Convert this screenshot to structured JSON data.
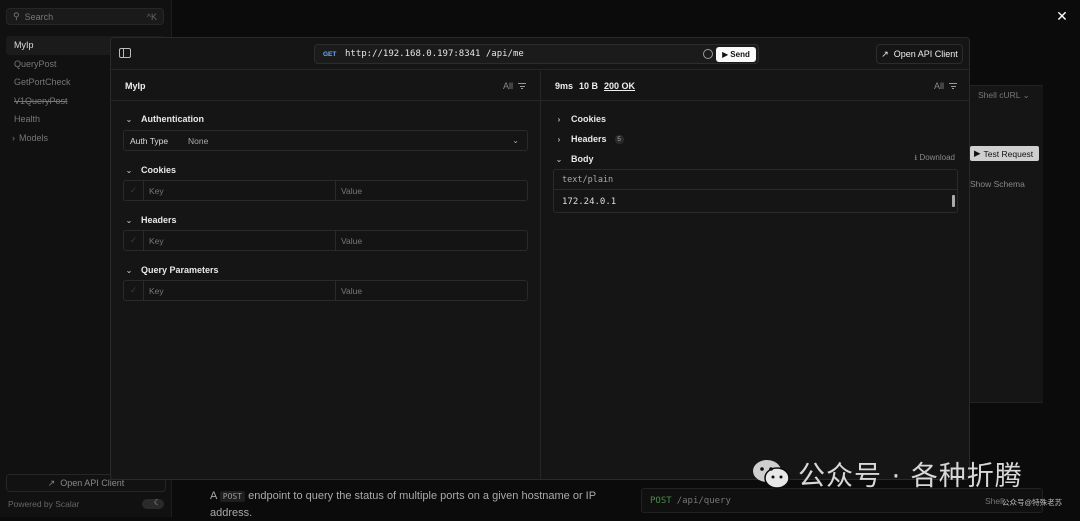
{
  "background": {
    "search": {
      "label": "Search",
      "shortcut": "^K"
    },
    "nav": [
      {
        "label": "MyIp",
        "active": true
      },
      {
        "label": "QueryPost"
      },
      {
        "label": "GetPortCheck"
      },
      {
        "label": "V1QueryPost",
        "strike": true
      },
      {
        "label": "Health"
      },
      {
        "label": "Models",
        "chevron": true
      }
    ],
    "open_api_label": "Open API Client",
    "powered_by": "Powered by Scalar",
    "close_glyph": "✕",
    "shell_label": "Shell cURL",
    "test_request_label": "Test Request",
    "show_schema_label": "Show Schema",
    "footer_text_pre": "A",
    "footer_code": "POST",
    "footer_text_post": "endpoint to query the status of multiple ports on a given hostname or IP address.",
    "post_method": "POST",
    "post_path": "/api/query",
    "shell_label_bottom": "Shell"
  },
  "watermark": {
    "text": "公众号 · 各种折腾",
    "sub": "公众号@特殊老苏"
  },
  "modal": {
    "method": "GET",
    "url": "http://192.168.0.197:8341 /api/me",
    "send_label": "Send",
    "open_api_label": "Open API Client",
    "request": {
      "title": "MyIp",
      "filter_label": "All",
      "auth_section": "Authentication",
      "auth_type_label": "Auth Type",
      "auth_type_value": "None",
      "cookies_section": "Cookies",
      "headers_section": "Headers",
      "query_section": "Query Parameters",
      "key_placeholder": "Key",
      "value_placeholder": "Value"
    },
    "response": {
      "time": "9ms",
      "size": "10 B",
      "status": "200 OK",
      "filter_label": "All",
      "cookies_section": "Cookies",
      "headers_section": "Headers",
      "headers_count": "5",
      "body_section": "Body",
      "download_label": "Download",
      "content_type": "text/plain",
      "body_content": "172.24.0.1"
    }
  },
  "colors": {
    "method_get": "#6aa8ff",
    "background": "#0b0b0b",
    "modal": "#151515"
  }
}
